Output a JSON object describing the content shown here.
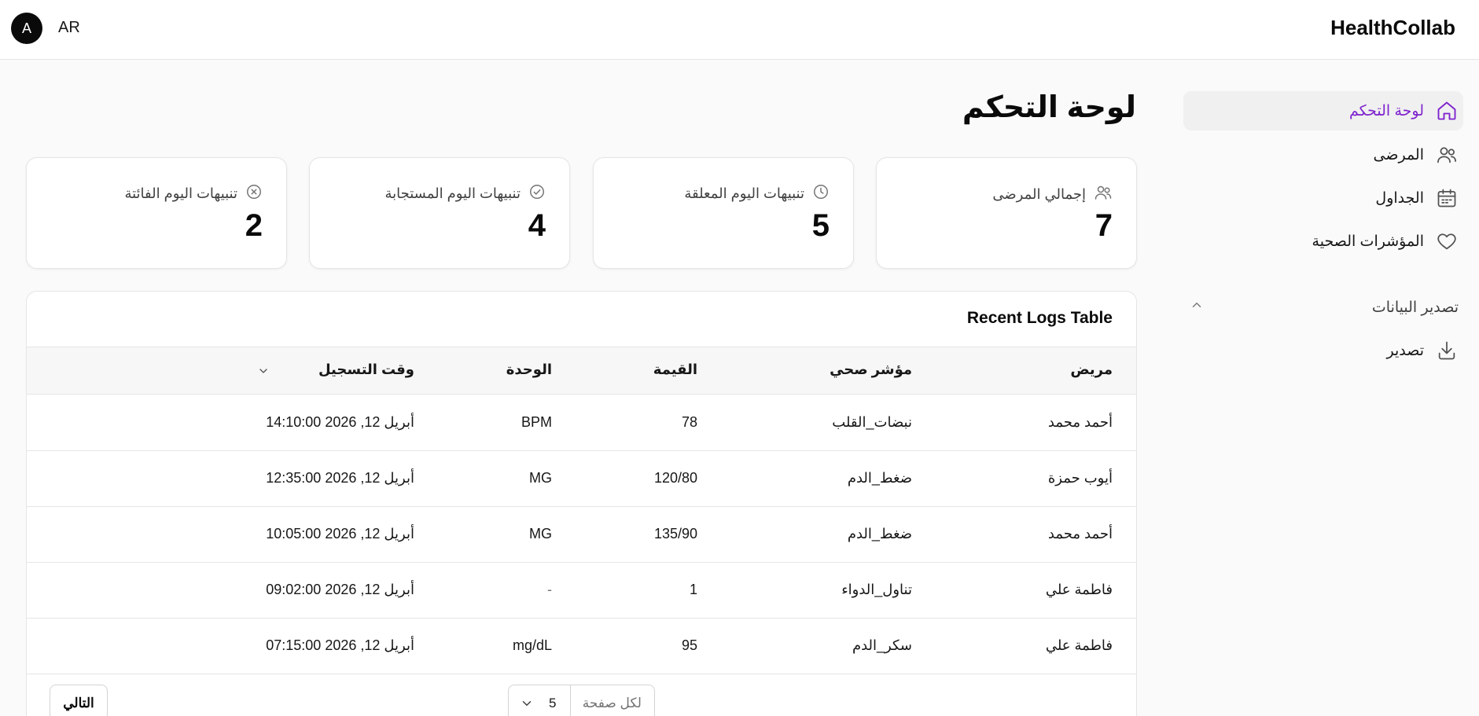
{
  "header": {
    "avatar_initial": "A",
    "language": "AR",
    "brand": "HealthCollab"
  },
  "sidebar": {
    "items": [
      {
        "label": "لوحة التحكم",
        "icon": "home-icon",
        "active": true
      },
      {
        "label": "المرضى",
        "icon": "users-icon"
      },
      {
        "label": "الجداول",
        "icon": "calendar-icon"
      },
      {
        "label": "المؤشرات الصحية",
        "icon": "heart-icon"
      }
    ],
    "group": {
      "label": "تصدير البيانات",
      "icon": "chevron-up-icon"
    },
    "group_items": [
      {
        "label": "تصدير",
        "icon": "download-icon"
      }
    ]
  },
  "page": {
    "title": "لوحة التحكم"
  },
  "stats": [
    {
      "label": "إجمالي المرضى",
      "value": "7",
      "icon": "users-icon"
    },
    {
      "label": "تنبيهات اليوم المعلقة",
      "value": "5",
      "icon": "clock-icon"
    },
    {
      "label": "تنبيهات اليوم المستجابة",
      "value": "4",
      "icon": "check-circle-icon"
    },
    {
      "label": "تنبيهات اليوم الفائتة",
      "value": "2",
      "icon": "x-circle-icon"
    }
  ],
  "table": {
    "title": "Recent Logs Table",
    "columns": {
      "patient": "مريض",
      "metric": "مؤشر صحي",
      "value": "القيمة",
      "unit": "الوحدة",
      "time": "وقت التسجيل"
    },
    "rows": [
      {
        "patient": "أحمد محمد",
        "metric": "نبضات_القلب",
        "value": "78",
        "unit": "BPM",
        "time": "أبريل 12, 2026 14:10:00"
      },
      {
        "patient": "أيوب حمزة",
        "metric": "ضغط_الدم",
        "value": "120/80",
        "unit": "MG",
        "time": "أبريل 12, 2026 12:35:00"
      },
      {
        "patient": "أحمد محمد",
        "metric": "ضغط_الدم",
        "value": "135/90",
        "unit": "MG",
        "time": "أبريل 12, 2026 10:05:00"
      },
      {
        "patient": "فاطمة علي",
        "metric": "تناول_الدواء",
        "value": "1",
        "unit": "-",
        "time": "أبريل 12, 2026 09:02:00"
      },
      {
        "patient": "فاطمة علي",
        "metric": "سكر_الدم",
        "value": "95",
        "unit": "mg/dL",
        "time": "أبريل 12, 2026 07:15:00"
      }
    ],
    "pagination": {
      "per_page_label": "لكل صفحة",
      "per_page_value": "5",
      "next_label": "التالي"
    }
  },
  "colors": {
    "accent": "#7e22ce",
    "border": "#e5e5e5"
  }
}
